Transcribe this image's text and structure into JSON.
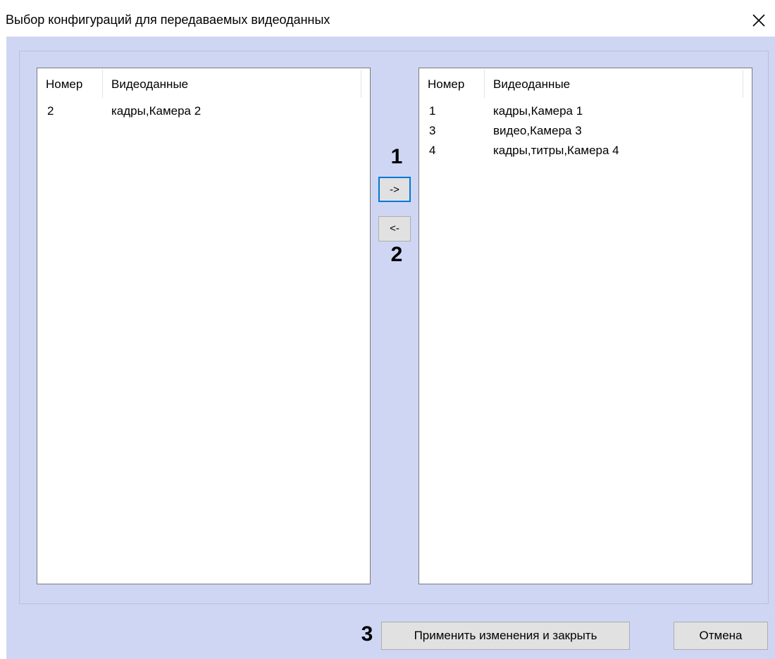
{
  "window": {
    "title": "Выбор конфигураций для передаваемых видеоданных",
    "close_icon": "close-icon"
  },
  "left_list": {
    "columns": [
      "Номер",
      "Видеоданные"
    ],
    "rows": [
      {
        "number": "2",
        "video": "кадры,Камера 2"
      }
    ]
  },
  "right_list": {
    "columns": [
      "Номер",
      "Видеоданные"
    ],
    "rows": [
      {
        "number": "1",
        "video": "кадры,Камера 1"
      },
      {
        "number": "3",
        "video": "видео,Камера 3"
      },
      {
        "number": "4",
        "video": "кадры,титры,Камера 4"
      }
    ]
  },
  "transfer": {
    "move_right_label": "->",
    "move_left_label": "<-"
  },
  "markers": {
    "m1": "1",
    "m2": "2",
    "m3": "3"
  },
  "footer": {
    "apply_label": "Применить изменения и закрыть",
    "cancel_label": "Отмена"
  },
  "colors": {
    "client_bg": "#ced6f4",
    "focus_border": "#0078d7"
  }
}
